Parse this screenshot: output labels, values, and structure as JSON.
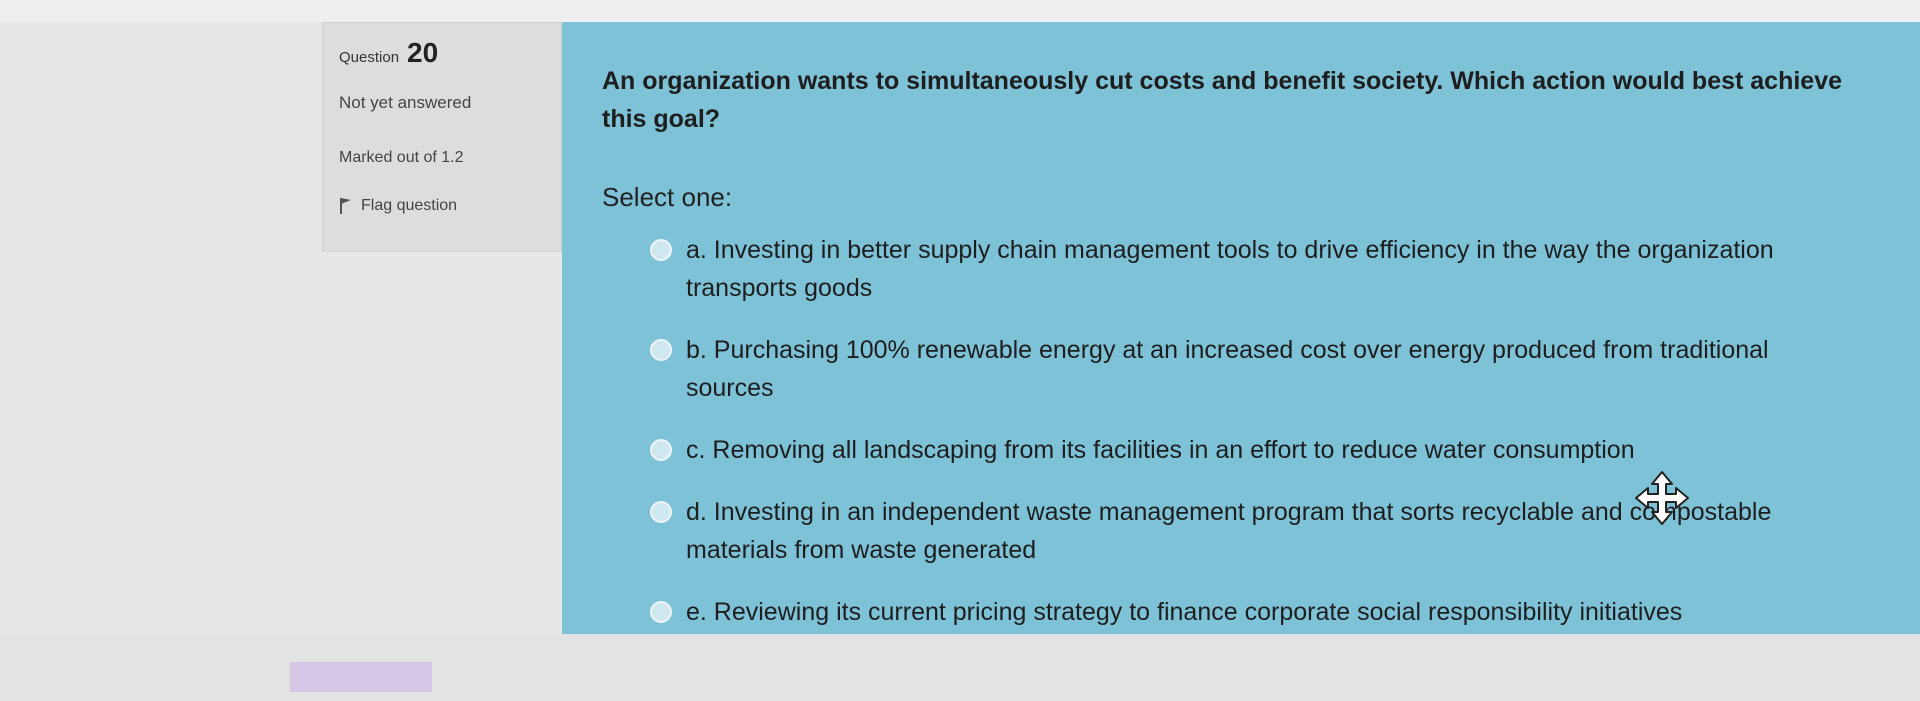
{
  "info": {
    "question_label": "Question",
    "question_number": "20",
    "state": "Not yet answered",
    "grade": "Marked out of 1.2",
    "flag_label": "Flag question"
  },
  "question": {
    "text": "An organization wants to simultaneously cut costs and benefit society. Which action would best achieve this goal?",
    "prompt": "Select one:",
    "answers": [
      {
        "text": "a. Investing in better supply chain management tools to drive efficiency in the way the organization transports goods"
      },
      {
        "text": "b. Purchasing 100% renewable energy at an increased cost over energy produced from traditional sources"
      },
      {
        "text": "c. Removing all landscaping from its facilities in an effort to reduce water consumption"
      },
      {
        "text": "d. Investing in an independent waste management program that sorts recyclable and compostable materials from waste generated"
      },
      {
        "text": "e. Reviewing its current pricing strategy to finance corporate social responsibility initiatives"
      }
    ]
  },
  "icons": {
    "flag": "flag-icon",
    "radio": "radio-icon",
    "cursor": "move-cursor-icon"
  },
  "colors": {
    "content_bg": "#7ec2d8",
    "info_bg": "#dcdedd",
    "button_purple": "#d6c7e6"
  }
}
